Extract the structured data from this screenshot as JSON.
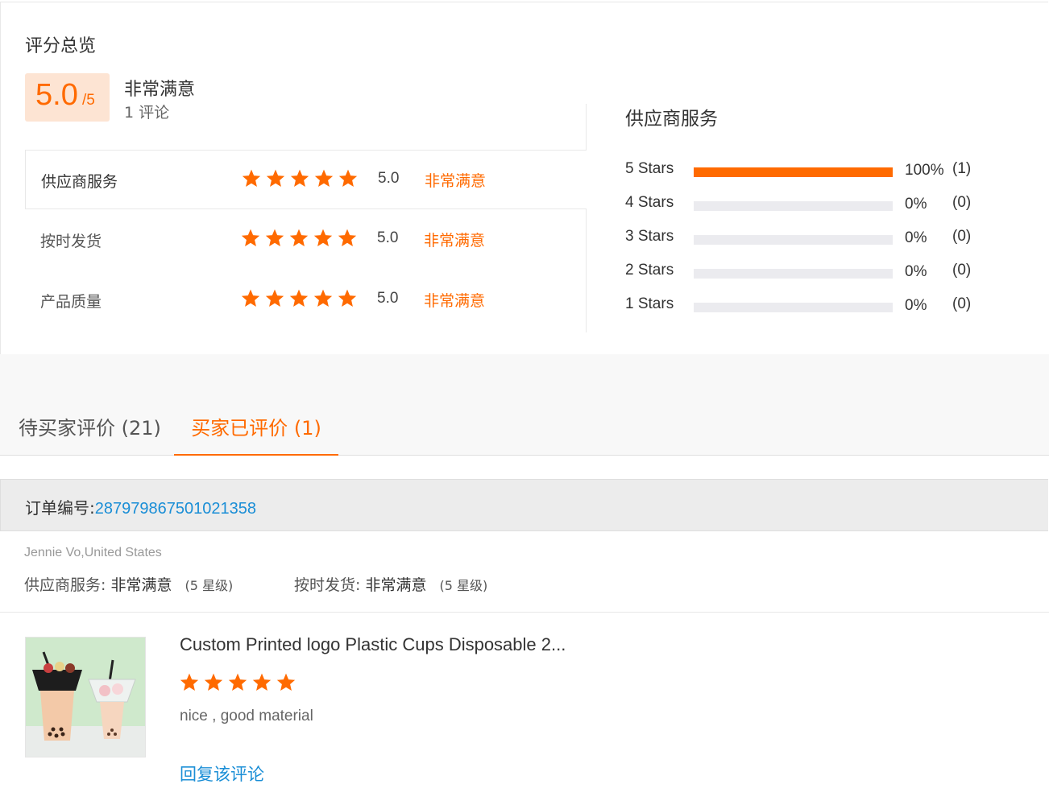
{
  "overview": {
    "title": "评分总览",
    "score": "5.0",
    "score_max": "/5",
    "level": "非常满意",
    "review_count": "1 评论",
    "rows": [
      {
        "label": "供应商服务",
        "rating": 5,
        "score": "5.0",
        "level": "非常满意"
      },
      {
        "label": "按时发货",
        "rating": 5,
        "score": "5.0",
        "level": "非常满意"
      },
      {
        "label": "产品质量",
        "rating": 5,
        "score": "5.0",
        "level": "非常满意"
      }
    ]
  },
  "distribution": {
    "title": "供应商服务",
    "rows": [
      {
        "label": "5  Stars",
        "fraction": 1.0,
        "pct": "100%",
        "count": "(1)"
      },
      {
        "label": "4  Stars",
        "fraction": 0.0,
        "pct": "0%",
        "count": "(0)"
      },
      {
        "label": "3  Stars",
        "fraction": 0.0,
        "pct": "0%",
        "count": "(0)"
      },
      {
        "label": "2  Stars",
        "fraction": 0.0,
        "pct": "0%",
        "count": "(0)"
      },
      {
        "label": "1  Stars",
        "fraction": 0.0,
        "pct": "0%",
        "count": "(0)"
      }
    ]
  },
  "tabs": {
    "pending": "待买家评价 (21)",
    "reviewed": "买家已评价 (1)"
  },
  "order": {
    "label": "订单编号:",
    "number": "287979867501021358",
    "reviewer": "Jennie Vo,United States",
    "meta1_label": "供应商服务:",
    "meta1_value": "非常满意",
    "meta1_stars": "(5 星级)",
    "meta2_label": "按时发货:",
    "meta2_value": "非常满意",
    "meta2_stars": "(5 星级)"
  },
  "review": {
    "product_title": "Custom Printed logo Plastic Cups Disposable 2...",
    "rating": 5,
    "text": "nice , good material",
    "reply_label": "回复该评论"
  },
  "colors": {
    "accent": "#ff6a00",
    "link": "#1a8ed6",
    "star_empty": "#ebebef"
  },
  "icons": {
    "star": "star-icon"
  }
}
